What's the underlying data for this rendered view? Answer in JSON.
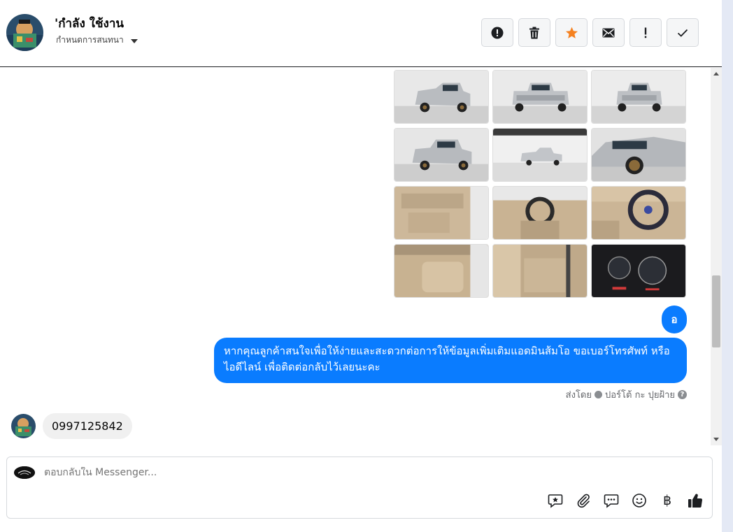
{
  "header": {
    "title": "'กำลัง ใช้งาน",
    "subtitle": "กำหนดการสนทนา",
    "tools": [
      {
        "icon": "alert-circle-icon"
      },
      {
        "icon": "trash-icon"
      },
      {
        "icon": "star-icon",
        "color": "#f5811f"
      },
      {
        "icon": "envelope-icon"
      },
      {
        "icon": "exclamation-icon"
      },
      {
        "icon": "check-icon"
      }
    ]
  },
  "messages": {
    "outgoing_short": "อ",
    "outgoing_long": "หากคุณลูกค้าสนใจเพื่อให้ง่ายและสะดวกต่อการให้ข้อมูลเพิ่มเติมแอดมินส้มโอ ขอเบอร์โทรศัพท์ หรือ ไอดีไลน์ เพื่อติดต่อกลับไว้เลยนะคะ",
    "sent_by_prefix": "ส่งโดย",
    "sent_by_name": "ปอร์โต้ กะ ปุยฝ้าย",
    "incoming": "0997125842"
  },
  "composer": {
    "placeholder": "ตอบกลับใน Messenger...",
    "baht_symbol": "฿"
  },
  "colors": {
    "accent": "#0a7cff",
    "star": "#f5811f"
  }
}
